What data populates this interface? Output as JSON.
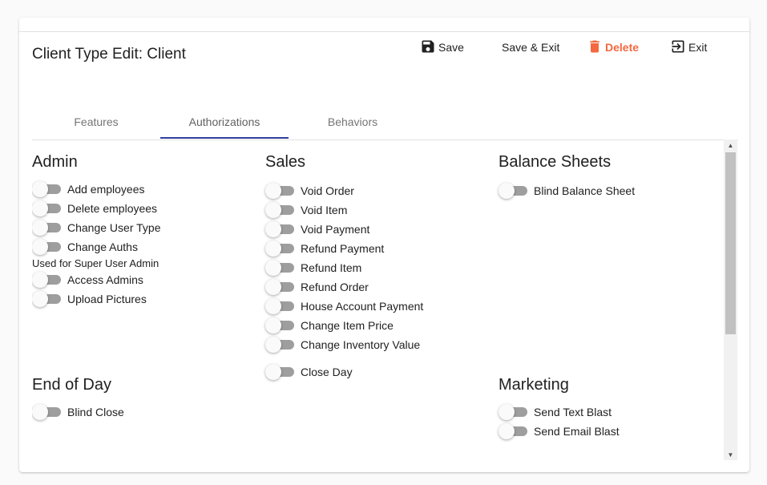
{
  "header": {
    "title": "Client Type Edit: Client"
  },
  "toolbar": {
    "save_label": "Save",
    "save_exit_label": "Save & Exit",
    "delete_label": "Delete",
    "exit_label": "Exit",
    "delete_color": "#f4683f"
  },
  "tabs": [
    {
      "label": "Features"
    },
    {
      "label": "Authorizations"
    },
    {
      "label": "Behaviors"
    }
  ],
  "admin": {
    "title": "Admin",
    "items": [
      "Add employees",
      "Delete employees",
      "Change User Type",
      "Change Auths"
    ],
    "note": "Used for Super User Admin",
    "items2": [
      "Access Admins",
      "Upload Pictures"
    ]
  },
  "sales": {
    "title": "Sales",
    "items": [
      "Void Order",
      "Void Item",
      "Void Payment",
      "Refund Payment",
      "Refund Item",
      "Refund Order",
      "House Account Payment",
      "Change Item Price",
      "Change Inventory Value",
      "Close Day"
    ]
  },
  "balance": {
    "title": "Balance Sheets",
    "items": [
      "Blind Balance Sheet"
    ]
  },
  "eod": {
    "title": "End of Day",
    "items": [
      "Blind Close"
    ]
  },
  "marketing": {
    "title": "Marketing",
    "items": [
      "Send Text Blast",
      "Send Email Blast"
    ]
  }
}
